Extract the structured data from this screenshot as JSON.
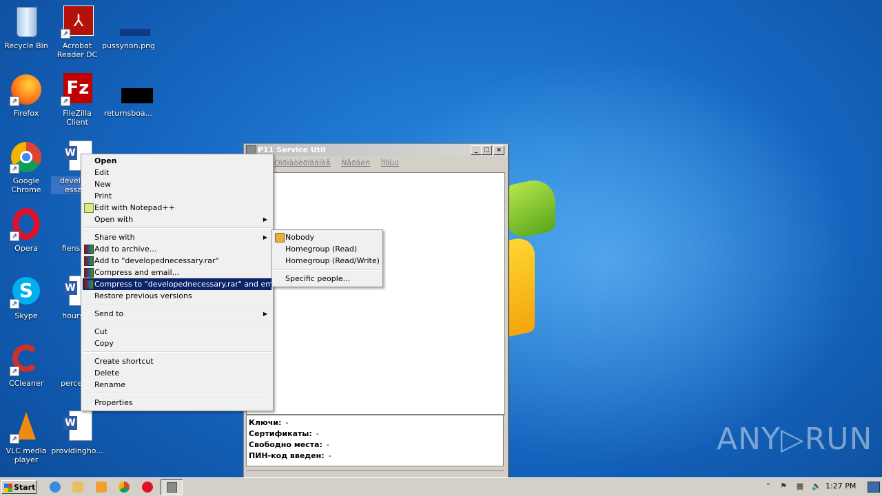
{
  "desktop": {
    "icons": [
      {
        "label": "Recycle Bin"
      },
      {
        "label": "Acrobat Reader DC"
      },
      {
        "label": "pussynon.png"
      },
      {
        "label": "Firefox"
      },
      {
        "label": "FileZilla Client"
      },
      {
        "label": "returnsboa..."
      },
      {
        "label": "Google Chrome"
      },
      {
        "label": "develope essary"
      },
      {
        "label": "Opera"
      },
      {
        "label": "fiensure"
      },
      {
        "label": "Skype"
      },
      {
        "label": "hoursus"
      },
      {
        "label": "CCleaner"
      },
      {
        "label": "percents"
      },
      {
        "label": "VLC media player"
      },
      {
        "label": "providingho..."
      }
    ]
  },
  "window": {
    "title": "P11 Service Util",
    "menu": [
      "Ôîðìàòèðîâàíèå",
      "Ñåðâèñ",
      "Ïîìîùü"
    ],
    "info": [
      {
        "label": "Ключи:",
        "value": "-"
      },
      {
        "label": "Сертификаты:",
        "value": "-"
      },
      {
        "label": "Свободно места:",
        "value": "-"
      },
      {
        "label": "ПИН-код введен:",
        "value": "-"
      }
    ]
  },
  "context_menu": {
    "items": [
      {
        "label": "Open"
      },
      {
        "label": "Edit"
      },
      {
        "label": "New"
      },
      {
        "label": "Print"
      },
      {
        "label": "Edit with Notepad++"
      },
      {
        "label": "Open with"
      },
      {
        "label": "Share with"
      },
      {
        "label": "Add to archive..."
      },
      {
        "label": "Add to \"developednecessary.rar\""
      },
      {
        "label": "Compress and email..."
      },
      {
        "label": "Compress to \"developednecessary.rar\" and email"
      },
      {
        "label": "Restore previous versions"
      },
      {
        "label": "Send to"
      },
      {
        "label": "Cut"
      },
      {
        "label": "Copy"
      },
      {
        "label": "Create shortcut"
      },
      {
        "label": "Delete"
      },
      {
        "label": "Rename"
      },
      {
        "label": "Properties"
      }
    ]
  },
  "share_submenu": {
    "items": [
      {
        "label": "Nobody"
      },
      {
        "label": "Homegroup (Read)"
      },
      {
        "label": "Homegroup (Read/Write)"
      },
      {
        "label": "Specific people..."
      }
    ]
  },
  "taskbar": {
    "start_label": "Start",
    "clock": "1:27 PM"
  },
  "watermark": "ANY▷RUN",
  "colors": {
    "menu_highlight": "#0a2468",
    "desktop_blue": "#1566c0"
  }
}
